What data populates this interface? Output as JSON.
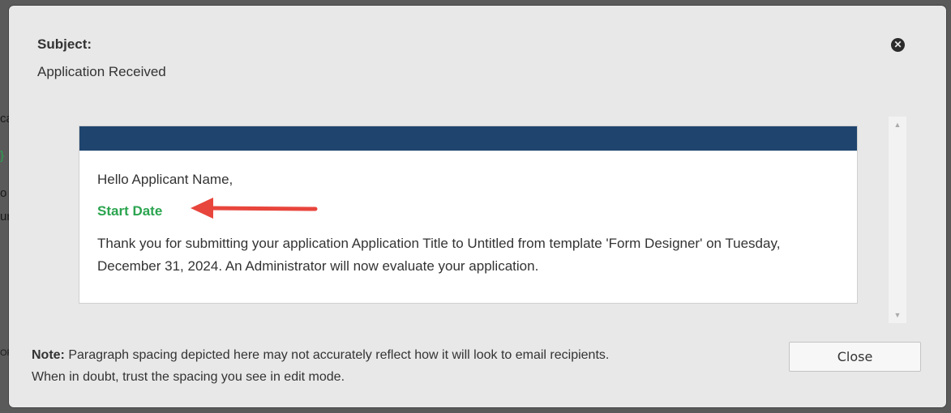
{
  "background": {
    "fragments": [
      "ca",
      "}",
      "o",
      "ur",
      "OR"
    ]
  },
  "modal": {
    "subject_label": "Subject:",
    "subject_value": "Application Received",
    "close_icon": "close-icon",
    "email": {
      "header_color": "#1f456e",
      "greeting": "Hello Applicant Name,",
      "start_date": "Start Date",
      "body": "Thank you for submitting your application Application Title to Untitled from template 'Form Designer' on Tuesday, December 31, 2024. An Administrator will now evaluate your application."
    },
    "note_label": "Note:",
    "note_line1": "Paragraph spacing depicted here may not accurately reflect how it will look to email recipients.",
    "note_line2": "When in doubt, trust the spacing you see in edit mode.",
    "close_button_label": "Close"
  },
  "colors": {
    "accent_green": "#2ba44f",
    "arrow_red": "#e8453c",
    "header_blue": "#1f456e"
  }
}
